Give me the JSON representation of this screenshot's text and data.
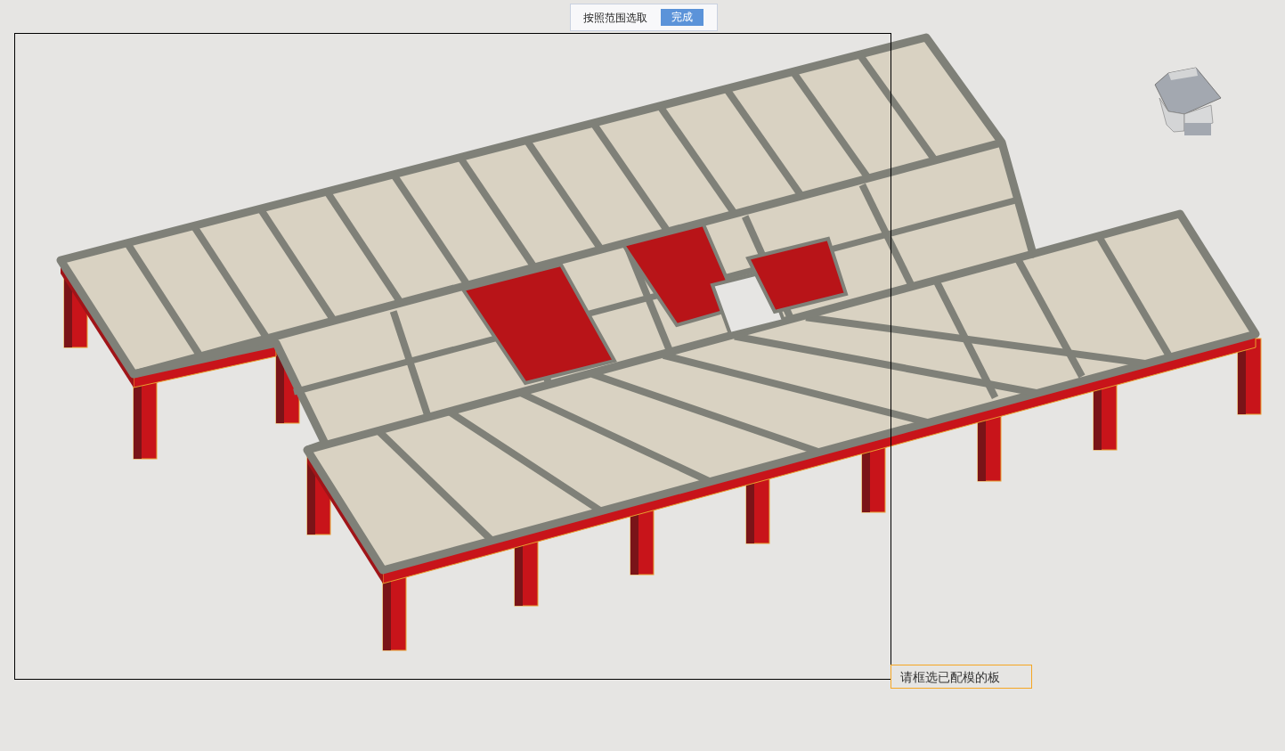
{
  "toolbar": {
    "label": "按照范围选取",
    "button": "完成"
  },
  "prompt": "请框选已配模的板"
}
